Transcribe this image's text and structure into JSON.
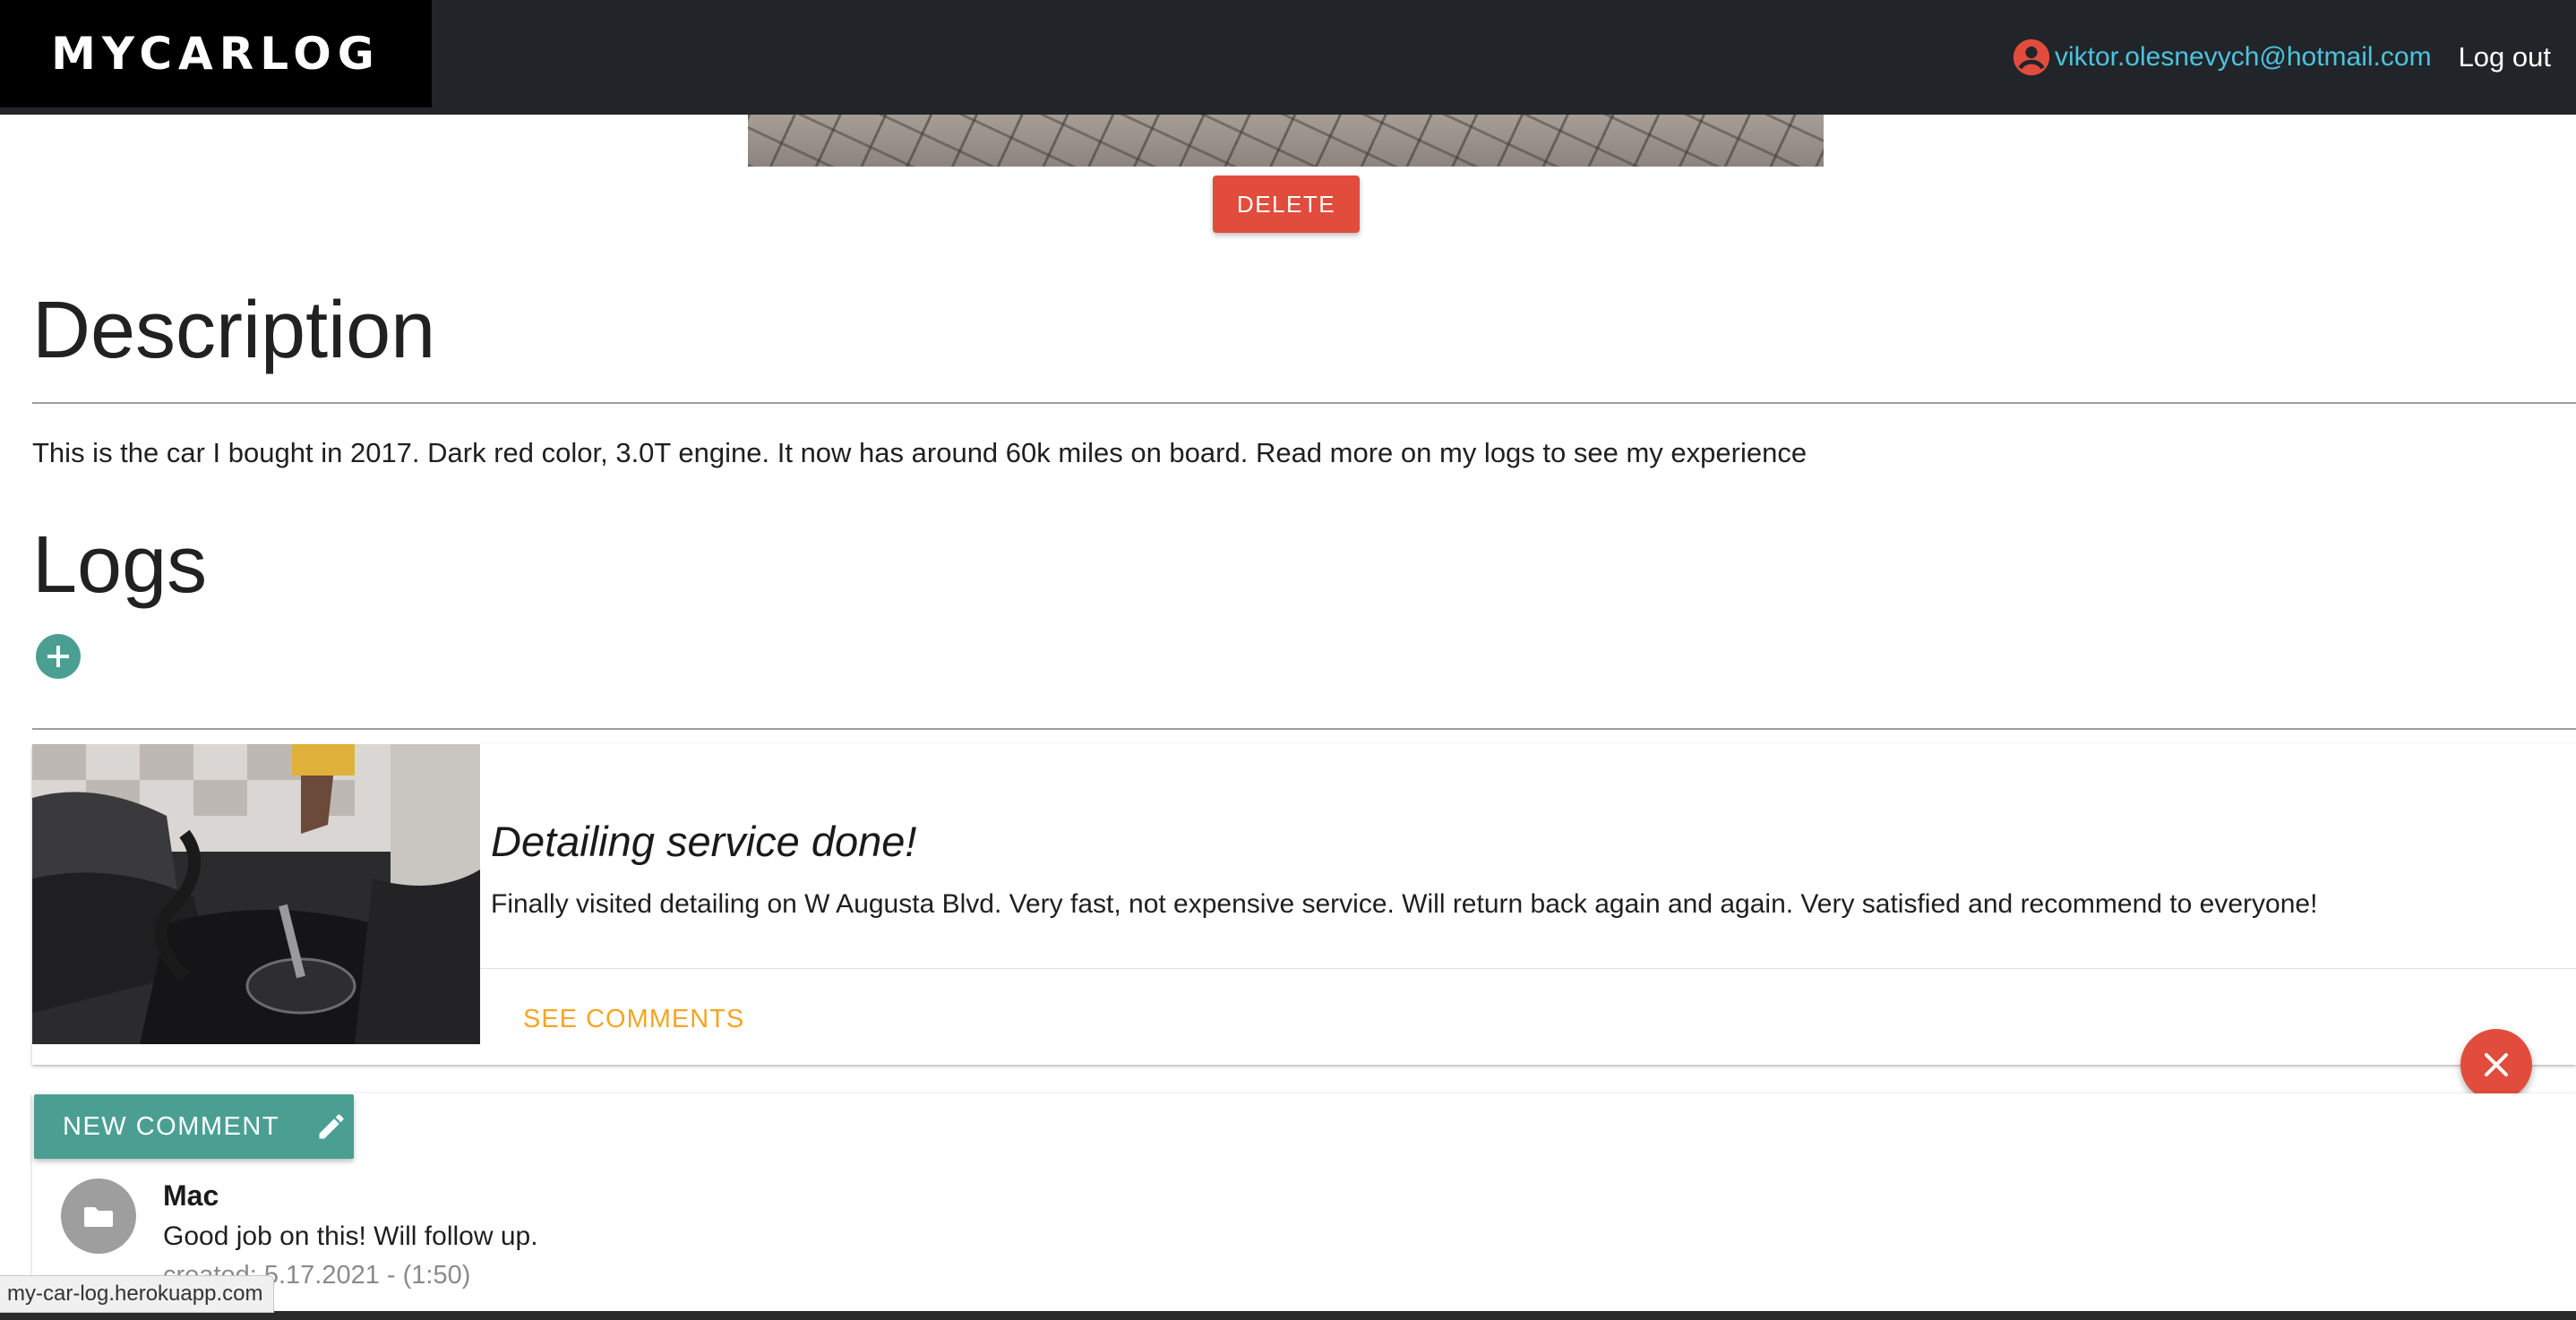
{
  "header": {
    "brand": "MYCARLOG",
    "user_email": "viktor.olesnevych@hotmail.com",
    "logout_label": "Log out",
    "user_icon": "account-circle-icon"
  },
  "car": {
    "delete_label": "DELETE"
  },
  "description": {
    "title": "Description",
    "text": "This is the car I bought in 2017. Dark red color, 3.0T engine. It now has around 60k miles on board. Read more on my logs to see my experience"
  },
  "logs": {
    "title": "Logs",
    "add_icon": "plus-circle-icon",
    "items": [
      {
        "title": "Detailing service done!",
        "text": "Finally visited detailing on W Augusta Blvd. Very fast, not expensive service. Will return back again and again. Very satisfied and recommend to everyone!",
        "see_comments_label": "SEE COMMENTS"
      }
    ]
  },
  "comments": {
    "new_comment_label": "NEW COMMENT",
    "items": [
      {
        "author": "Mac",
        "text": "Good job on this! Will follow up.",
        "date": "created: 5.17.2021 - (1:50)"
      }
    ]
  },
  "status_bar": {
    "url": "my-car-log.herokuapp.com"
  },
  "colors": {
    "navbar": "#212529",
    "accent_teal": "#4a9f92",
    "danger": "#e24c3c",
    "link_orange": "#f5a623",
    "email_blue": "#4cc3df"
  }
}
